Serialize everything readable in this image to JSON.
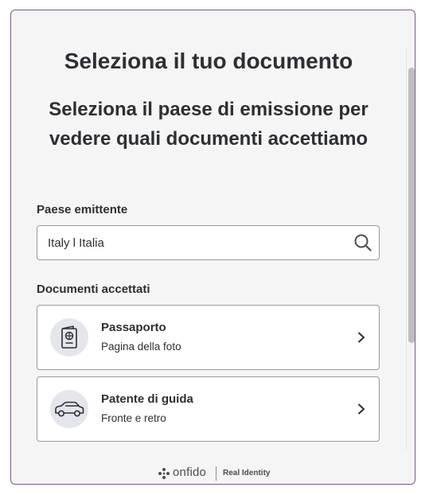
{
  "header": {
    "title": "Seleziona il tuo documento",
    "subtitle": "Seleziona il paese di emissione per vedere quali documenti accettiamo"
  },
  "country": {
    "label": "Paese emittente",
    "value": "Italy l Italia",
    "icon": "search-icon"
  },
  "documents": {
    "label": "Documenti accettati",
    "items": [
      {
        "title": "Passaporto",
        "subtitle": "Pagina della foto",
        "icon": "passport-icon"
      },
      {
        "title": "Patente di guida",
        "subtitle": "Fronte e retro",
        "icon": "car-icon"
      }
    ]
  },
  "footer": {
    "brand": "onfido",
    "tagline": "Real Identity"
  },
  "colors": {
    "border_accent": "#7a5a8a",
    "text": "#2c2f33",
    "icon_bg": "#e4e6ec"
  }
}
